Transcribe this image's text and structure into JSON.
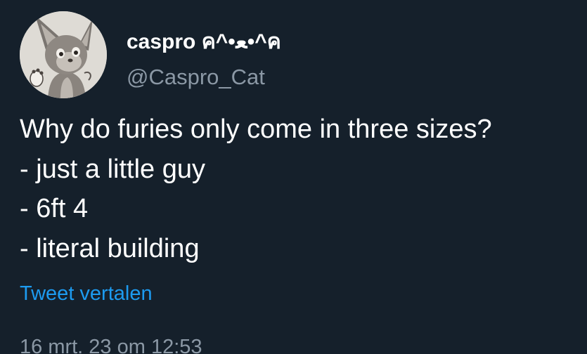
{
  "user": {
    "display_name": "caspro ค^•ﻌ•^ค",
    "handle": "@Caspro_Cat",
    "avatar_icon": "cat-fursona-avatar"
  },
  "tweet": {
    "lines": [
      "Why do furies only come in three sizes?",
      "- just a little guy",
      "- 6ft 4",
      "- literal building"
    ],
    "translate_label": "Tweet vertalen",
    "timestamp": "16 mrt. 23 om 12:53"
  },
  "colors": {
    "background": "#15202b",
    "text": "#ffffff",
    "secondary_text": "#8b98a5",
    "link": "#1d9bf0"
  }
}
